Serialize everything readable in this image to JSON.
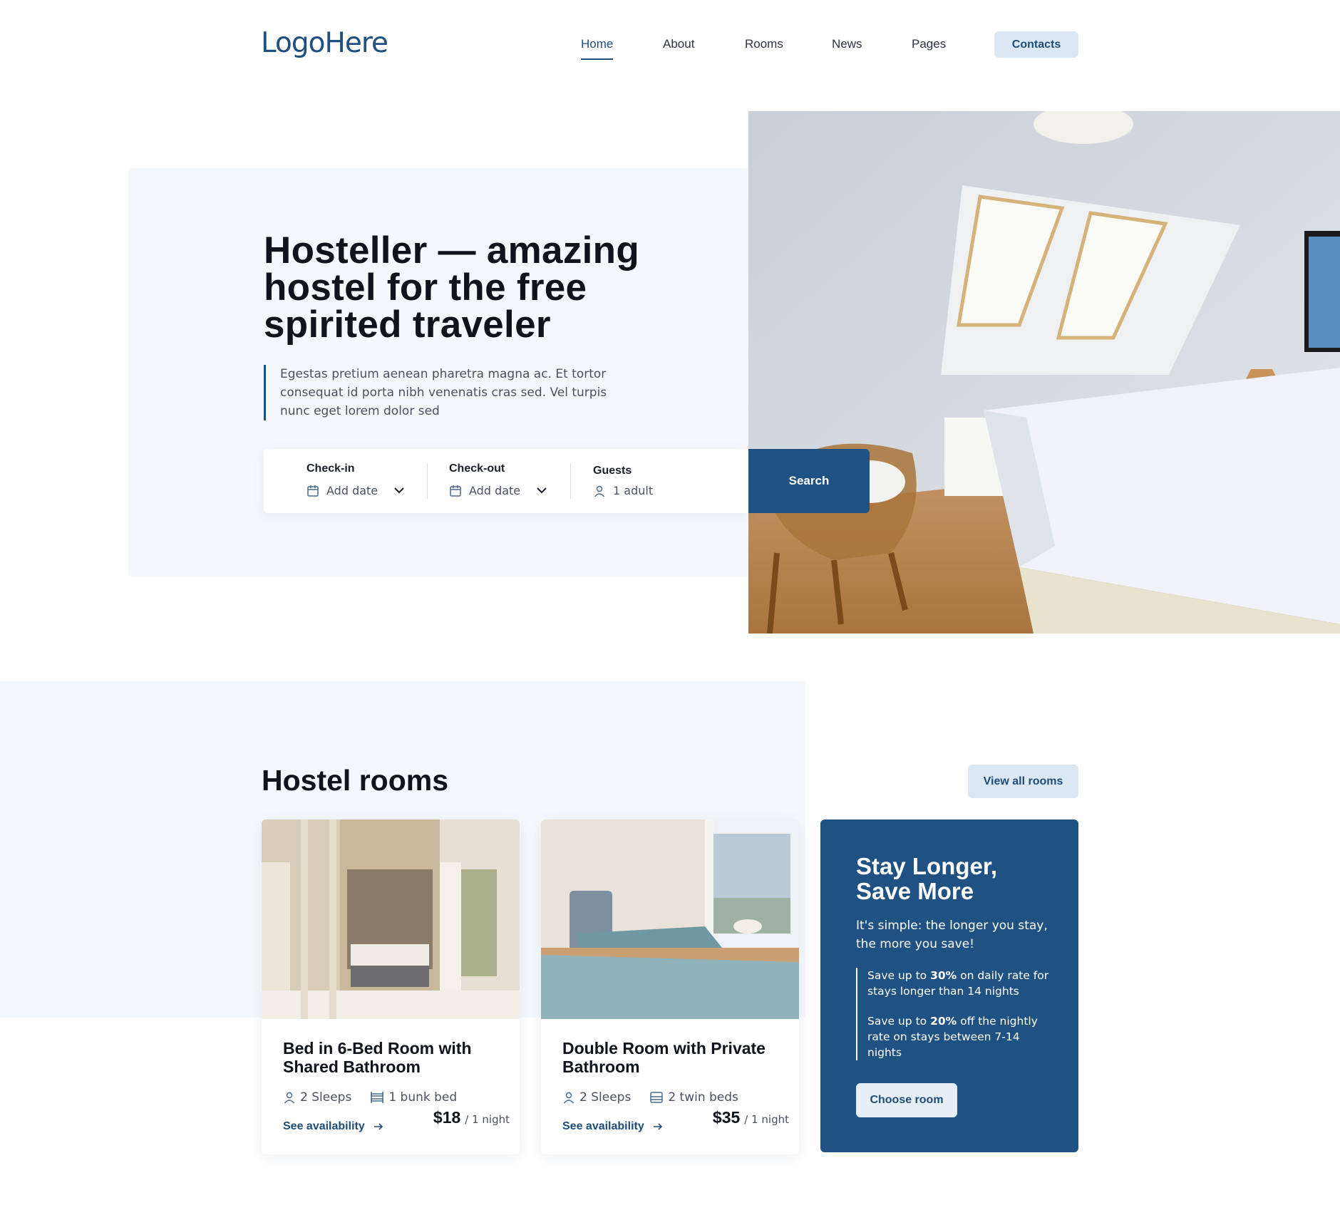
{
  "header": {
    "logo": "LogoHere",
    "nav": [
      {
        "label": "Home",
        "active": true
      },
      {
        "label": "About",
        "active": false
      },
      {
        "label": "Rooms",
        "active": false
      },
      {
        "label": "News",
        "active": false
      },
      {
        "label": "Pages",
        "active": false
      }
    ],
    "contacts_label": "Contacts"
  },
  "hero": {
    "title": "Hosteller — amazing hostel for the free spirited traveler",
    "description": "Egestas pretium aenean pharetra magna ac. Et tortor consequat id porta nibh venenatis cras sed. Vel turpis nunc eget lorem dolor sed",
    "booking": {
      "checkin_label": "Check-in",
      "checkin_value": "Add date",
      "checkout_label": "Check-out",
      "checkout_value": "Add date",
      "guests_label": "Guests",
      "guests_value": "1 adult",
      "search_label": "Search"
    }
  },
  "rooms": {
    "title": "Hostel rooms",
    "view_all_label": "View all rooms",
    "cards": [
      {
        "price": "$18",
        "unit": "/ 1 night",
        "title": "Bed in 6-Bed Room with Shared Bathroom",
        "sleeps": "2 Sleeps",
        "beds": "1 bunk bed",
        "link": "See availability"
      },
      {
        "price": "$35",
        "unit": "/ 1 night",
        "title": "Double Room with Private Bathroom",
        "sleeps": "2 Sleeps",
        "beds": "2 twin beds",
        "link": "See availability"
      }
    ],
    "promo": {
      "title": "Stay Longer, Save More",
      "subtitle": "It's simple: the longer you stay, the more you save!",
      "item1_pre": "Save up to ",
      "item1_bold": "30%",
      "item1_post": " on daily rate for stays longer than 14 nights",
      "item2_pre": "Save up to ",
      "item2_bold": "20%",
      "item2_post": " off the nightly rate on stays between 7-14 nights",
      "button_label": "Choose room"
    }
  },
  "colors": {
    "brand": "#1f5282",
    "accent_light": "#dce7f4",
    "section_bg": "#f5f8fb"
  }
}
